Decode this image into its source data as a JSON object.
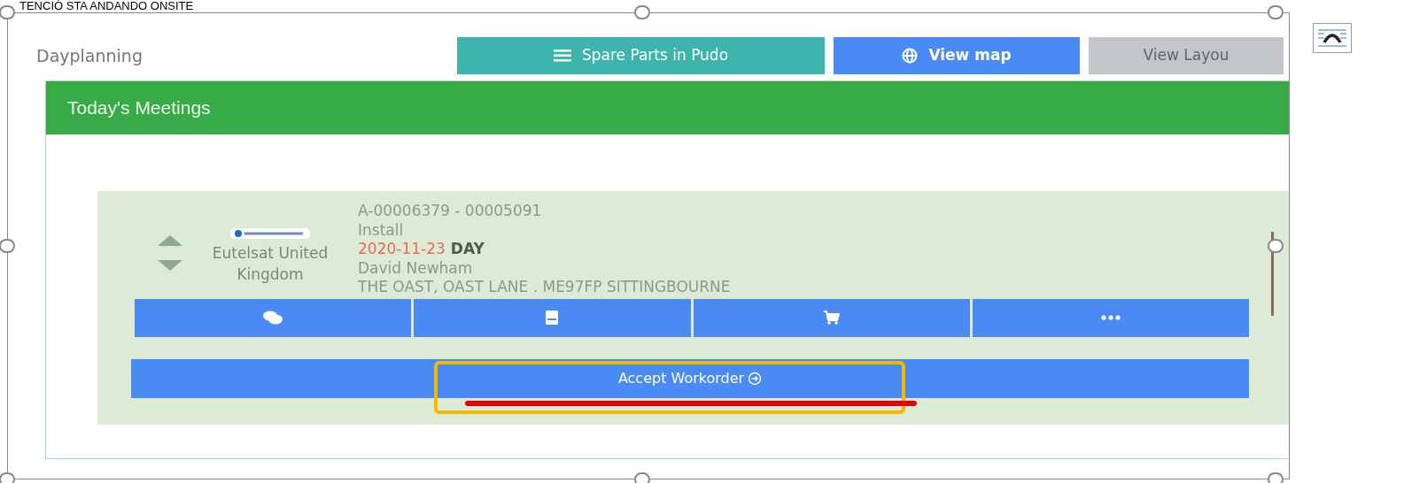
{
  "top_text": "TENCIÓ STA ANDANDO ONSITE",
  "panel": {
    "title": "Dayplanning",
    "buttons": [
      {
        "label": "Spare Parts in Pudo",
        "kind": "list",
        "disabled": false
      },
      {
        "label": "View map",
        "kind": "globe",
        "disabled": false
      },
      {
        "label": "View Layou",
        "kind": "plain",
        "disabled": true
      }
    ]
  },
  "meetings": {
    "title": "Today's Meetings",
    "items": [
      {
        "company": "Eutelsat United Kingdom",
        "ref": "A-00006379 - 00005091",
        "type": "Install",
        "date": "2020-11-23",
        "shift": "DAY",
        "contact": "David Newham",
        "address": "THE OAST, OAST LANE . ME97FP SITTINGBOURNE",
        "actions": [
          {
            "kind": "chat"
          },
          {
            "kind": "note"
          },
          {
            "kind": "cart"
          },
          {
            "kind": "more"
          }
        ],
        "accept": "Accept Workorder"
      }
    ]
  }
}
